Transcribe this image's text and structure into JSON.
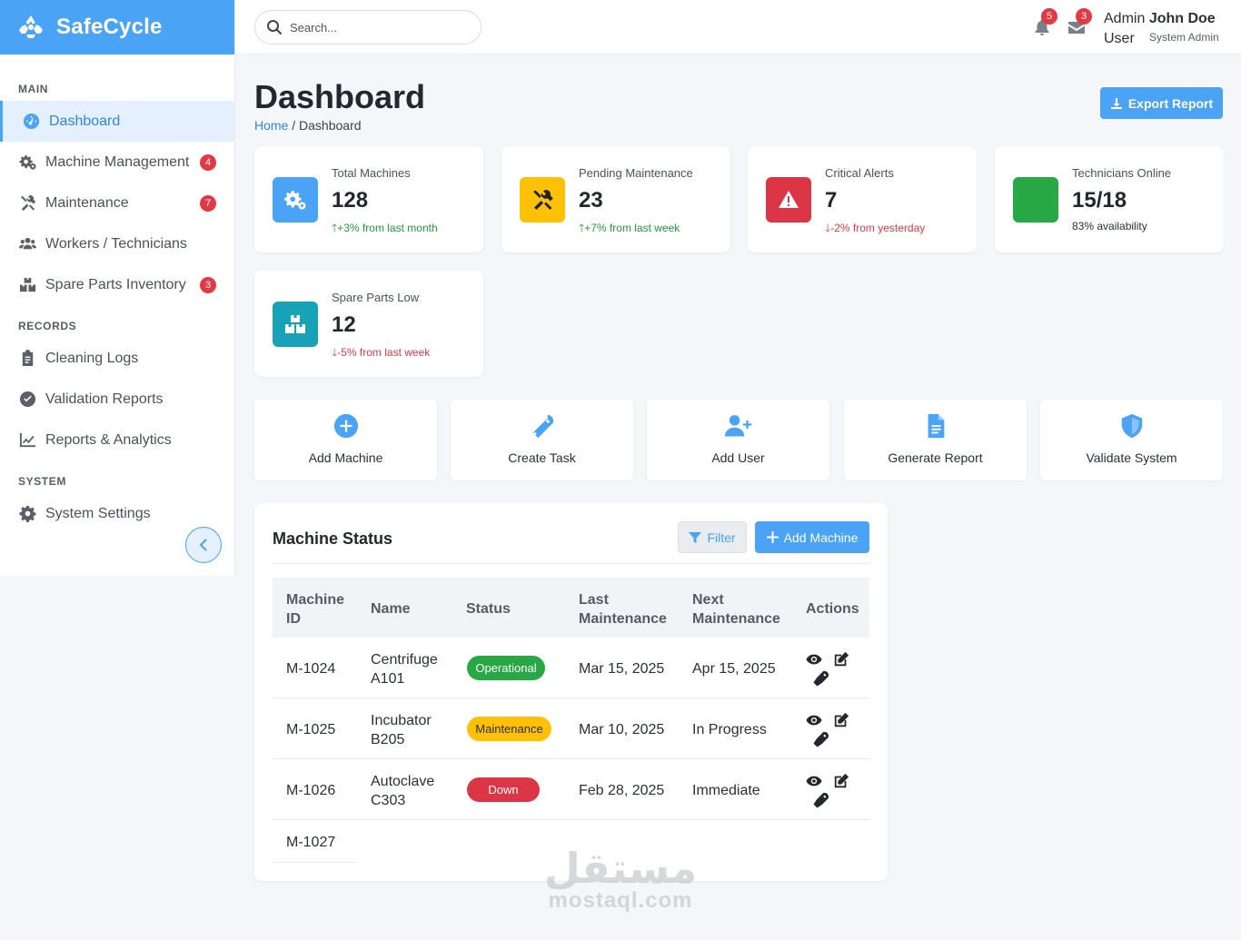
{
  "app": {
    "name": "SafeCycle"
  },
  "sidebar": {
    "sections": {
      "main": "MAIN",
      "records": "RECORDS",
      "system": "SYSTEM"
    },
    "items": [
      {
        "label": "Dashboard",
        "icon": "gauge-icon",
        "active": true
      },
      {
        "label": "Machine Management",
        "icon": "gears-icon",
        "badge": "4"
      },
      {
        "label": "Maintenance",
        "icon": "tools-icon",
        "badge": "7"
      },
      {
        "label": "Workers / Technicians",
        "icon": "users-icon"
      },
      {
        "label": "Spare Parts Inventory",
        "icon": "boxes-icon",
        "badge": "3"
      },
      {
        "label": "Cleaning Logs",
        "icon": "clipboard-icon"
      },
      {
        "label": "Validation Reports",
        "icon": "check-circle-icon"
      },
      {
        "label": "Reports & Analytics",
        "icon": "chart-line-icon"
      },
      {
        "label": "System Settings",
        "icon": "gear-icon"
      }
    ]
  },
  "topbar": {
    "search_placeholder": "Search...",
    "notifications_badge": "5",
    "messages_badge": "3",
    "user": {
      "prefix": "Admin",
      "name": "John Doe",
      "second_line": "User",
      "role": "System Admin"
    }
  },
  "header": {
    "title": "Dashboard",
    "breadcrumb_home": "Home",
    "breadcrumb_sep": " / ",
    "breadcrumb_current": "Dashboard",
    "export_label": "Export Report"
  },
  "stats": [
    {
      "label": "Total Machines",
      "value": "128",
      "trend": "+3% from last month",
      "trend_dir": "up",
      "color": "#4aa3f5",
      "icon": "gears-icon"
    },
    {
      "label": "Pending Maintenance",
      "value": "23",
      "trend": "+7% from last week",
      "trend_dir": "up",
      "color": "#ffc107",
      "icon": "tools-icon"
    },
    {
      "label": "Critical Alerts",
      "value": "7",
      "trend": "-2% from yesterday",
      "trend_dir": "down",
      "color": "#dc3545",
      "icon": "warning-icon"
    },
    {
      "label": "Technicians Online",
      "value": "15/18",
      "trend": "83% availability",
      "trend_dir": "neutral",
      "color": "#28a745",
      "icon": "none"
    },
    {
      "label": "Spare Parts Low",
      "value": "12",
      "trend": "-5% from last week",
      "trend_dir": "down",
      "color": "#17a2b8",
      "icon": "boxes-icon"
    }
  ],
  "quick_actions": [
    {
      "label": "Add Machine",
      "icon": "plus-circle-icon"
    },
    {
      "label": "Create Task",
      "icon": "wrench-icon"
    },
    {
      "label": "Add User",
      "icon": "user-plus-icon"
    },
    {
      "label": "Generate Report",
      "icon": "file-icon"
    },
    {
      "label": "Validate System",
      "icon": "shield-icon"
    }
  ],
  "machine_status": {
    "title": "Machine Status",
    "filter_label": "Filter",
    "add_label": "Add Machine",
    "columns": [
      {
        "line1": "Machine",
        "line2": "ID"
      },
      {
        "line1": "Name",
        "line2": ""
      },
      {
        "line1": "Status",
        "line2": ""
      },
      {
        "line1": "Last",
        "line2": "Maintenance"
      },
      {
        "line1": "Next",
        "line2": "Maintenance"
      },
      {
        "line1": "Actions",
        "line2": ""
      }
    ],
    "rows": [
      {
        "id": "M-1024",
        "name1": "Centrifuge",
        "name2": "A101",
        "status": "Operational",
        "last": "Mar 15, 2025",
        "next": "Apr 15, 2025"
      },
      {
        "id": "M-1025",
        "name1": "Incubator",
        "name2": "B205",
        "status": "Maintenance",
        "last": "Mar 10, 2025",
        "next": "In Progress"
      },
      {
        "id": "M-1026",
        "name1": "Autoclave",
        "name2": "C303",
        "status": "Down",
        "last": "Feb 28, 2025",
        "next": "Immediate"
      },
      {
        "id": "M-1027"
      }
    ]
  },
  "watermark": {
    "arabic": "مستقل",
    "latin": "mostaql.com"
  }
}
